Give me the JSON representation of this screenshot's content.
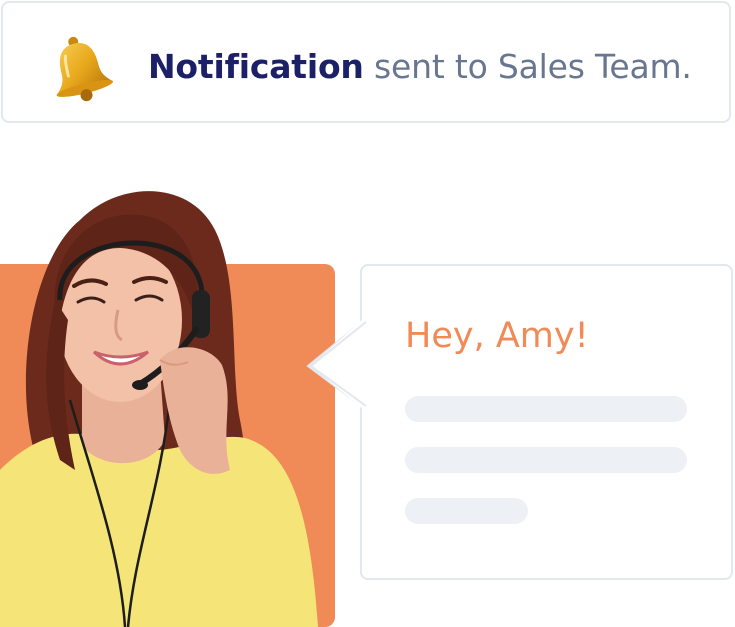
{
  "notification": {
    "highlight": "Notification",
    "rest": " sent to Sales Team.",
    "icon": "bell-icon"
  },
  "chat": {
    "greeting": "Hey, Amy!"
  },
  "colors": {
    "accent_orange": "#f08b58",
    "navy": "#1b2068",
    "slate": "#68778f",
    "placeholder": "#edf0f4",
    "border": "#e3e7ee"
  }
}
